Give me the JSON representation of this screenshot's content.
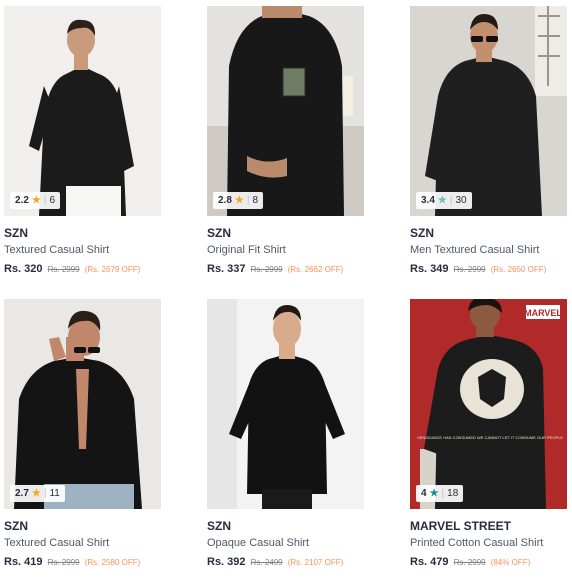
{
  "products": [
    {
      "brand": "SZN",
      "title": "Textured Casual Shirt",
      "price": "Rs. 320",
      "mrp": "Rs. 2999",
      "discount": "(Rs. 2679 OFF)",
      "rating": "2.2",
      "rating_count": "6",
      "star_color": "#f5a623",
      "background": "#f1efed"
    },
    {
      "brand": "SZN",
      "title": "Original Fit Shirt",
      "price": "Rs. 337",
      "mrp": "Rs. 2999",
      "discount": "(Rs. 2662 OFF)",
      "rating": "2.8",
      "rating_count": "8",
      "star_color": "#f5a623",
      "background": "#e4e2de"
    },
    {
      "brand": "SZN",
      "title": "Men Textured Casual Shirt",
      "price": "Rs. 349",
      "mrp": "Rs. 2999",
      "discount": "(Rs. 2650 OFF)",
      "rating": "3.4",
      "rating_count": "30",
      "star_color": "#72bcb7",
      "background": "#d9d6d1"
    },
    {
      "brand": "SZN",
      "title": "Textured Casual Shirt",
      "price": "Rs. 419",
      "mrp": "Rs. 2999",
      "discount": "(Rs. 2580 OFF)",
      "rating": "2.7",
      "rating_count": "11",
      "star_color": "#f5a623",
      "background": "#eae8e6"
    },
    {
      "brand": "SZN",
      "title": "Opaque Casual Shirt",
      "price": "Rs. 392",
      "mrp": "Rs. 2499",
      "discount": "(Rs. 2107 OFF)",
      "rating": null,
      "rating_count": null,
      "star_color": "#f5a623",
      "background": "#f3f3f3"
    },
    {
      "brand": "MARVEL STREET",
      "title": "Printed Cotton Casual Shirt",
      "price": "Rs. 479",
      "mrp": "Rs. 2999",
      "discount": "(84% OFF)",
      "rating": "4",
      "rating_count": "18",
      "star_color": "#14958f",
      "background": "#b02a2a",
      "badge_text": "MARVEL",
      "print_text": "VENGEANCE HAS CONSUMED WE CANNOT LET IT CONSUME OUR PEOPLE"
    }
  ]
}
